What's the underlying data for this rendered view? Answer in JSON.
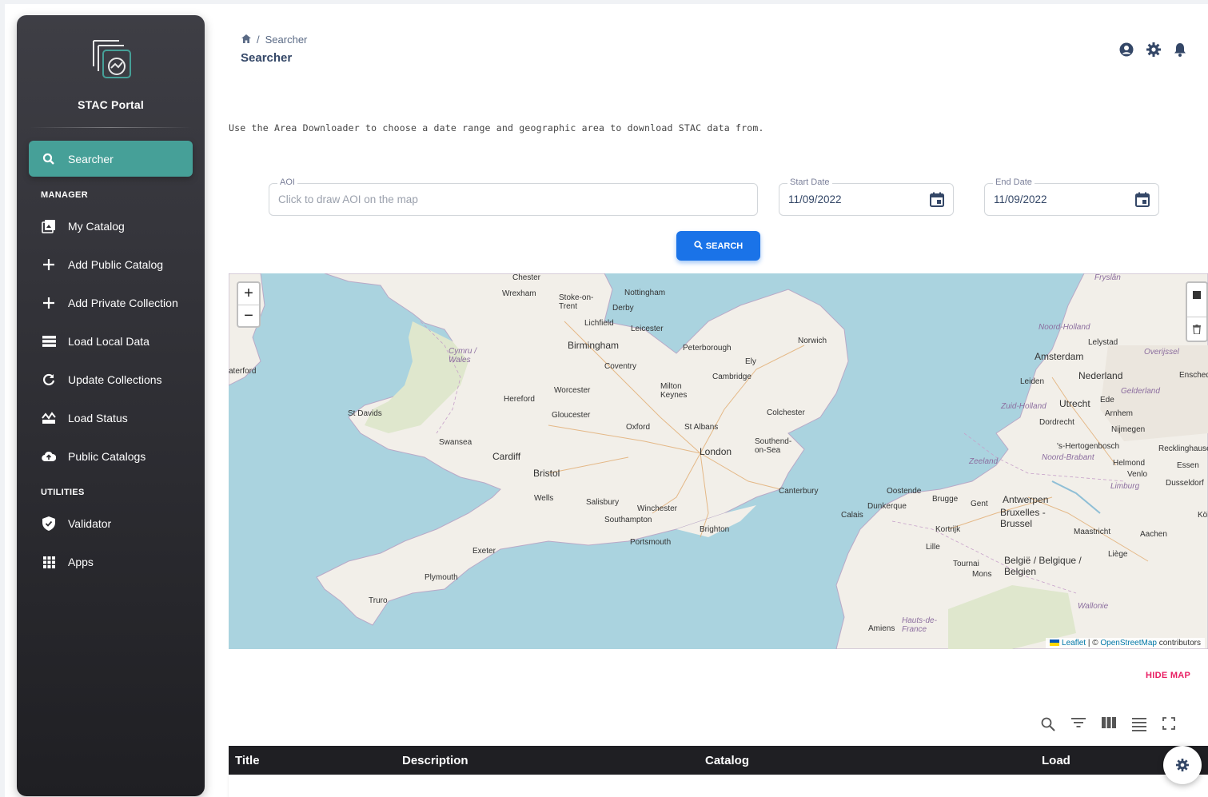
{
  "sidebar": {
    "brand": "STAC Portal",
    "active_item": "Searcher",
    "sections": [
      {
        "title": "MANAGER",
        "items": [
          "My Catalog",
          "Add Public Catalog",
          "Add Private Collection",
          "Load Local Data",
          "Update Collections",
          "Load Status",
          "Public Catalogs"
        ]
      },
      {
        "title": "UTILITIES",
        "items": [
          "Validator",
          "Apps"
        ]
      }
    ]
  },
  "header": {
    "breadcrumb_current": "Searcher",
    "title": "Searcher"
  },
  "intro": "Use the Area Downloader to choose a date range and geographic area to download STAC data from.",
  "form": {
    "aoi_label": "AOI",
    "aoi_placeholder": "Click to draw AOI on the map",
    "start_label": "Start Date",
    "start_value": "11/09/2022",
    "end_label": "End Date",
    "end_value": "11/09/2022",
    "search_label": "SEARCH"
  },
  "map": {
    "zoom_in": "+",
    "zoom_out": "−",
    "attribution_leaflet": "Leaflet",
    "attribution_sep": " | © ",
    "attribution_osm": "OpenStreetMap",
    "attribution_tail": " contributors",
    "labels": [
      "Chester",
      "Wrexham",
      "Stoke-on-Trent",
      "Nottingham",
      "Derby",
      "Lichfield",
      "Leicester",
      "Birmingham",
      "Peterborough",
      "Norwich",
      "Coventry",
      "Ely",
      "Cambridge",
      "Worcester",
      "Milton Keynes",
      "Hereford",
      "Gloucester",
      "Colchester",
      "St Davids",
      "Oxford",
      "St Albans",
      "Swansea",
      "Cardiff",
      "London",
      "Southend-on-Sea",
      "Bristol",
      "Canterbury",
      "Wells",
      "Salisbury",
      "Winchester",
      "Southampton",
      "Brighton",
      "Portsmouth",
      "Exeter",
      "Plymouth",
      "Truro",
      "Cymru / Wales",
      "aterford",
      "Amsterdam",
      "Nederland",
      "Leiden",
      "Utrecht",
      "Ede",
      "Lelystad",
      "Noord-Holland",
      "Overijssel",
      "Gelderland",
      "Arnhem",
      "Zuid-Holland",
      "Dordrecht",
      "Nijmegen",
      "'s-Hertogenbosch",
      "Noord-Brabant",
      "Zeeland",
      "Helmond",
      "Venlo",
      "Limburg",
      "Dusseldorf",
      "Essen",
      "Recklinghausen",
      "Oostende",
      "Brugge",
      "Gent",
      "Antwerpen",
      "Bruxelles - Brussel",
      "Dunkerque",
      "Calais",
      "Kortrijk",
      "Lille",
      "Tournai",
      "Mons",
      "Maastricht",
      "Aachen",
      "Liège",
      "België / Belgique / Belgien",
      "Wallonie",
      "Hauts-de-France",
      "Amiens",
      "Köln",
      "Fryslân",
      "Enschede"
    ]
  },
  "hide_map": "HIDE MAP",
  "table": {
    "columns": [
      "Title",
      "Description",
      "Catalog",
      "Load"
    ]
  },
  "colors": {
    "accent": "#46a098",
    "primary": "#1a73e8",
    "danger": "#e91e63",
    "sidebar": "#2b2b30"
  }
}
